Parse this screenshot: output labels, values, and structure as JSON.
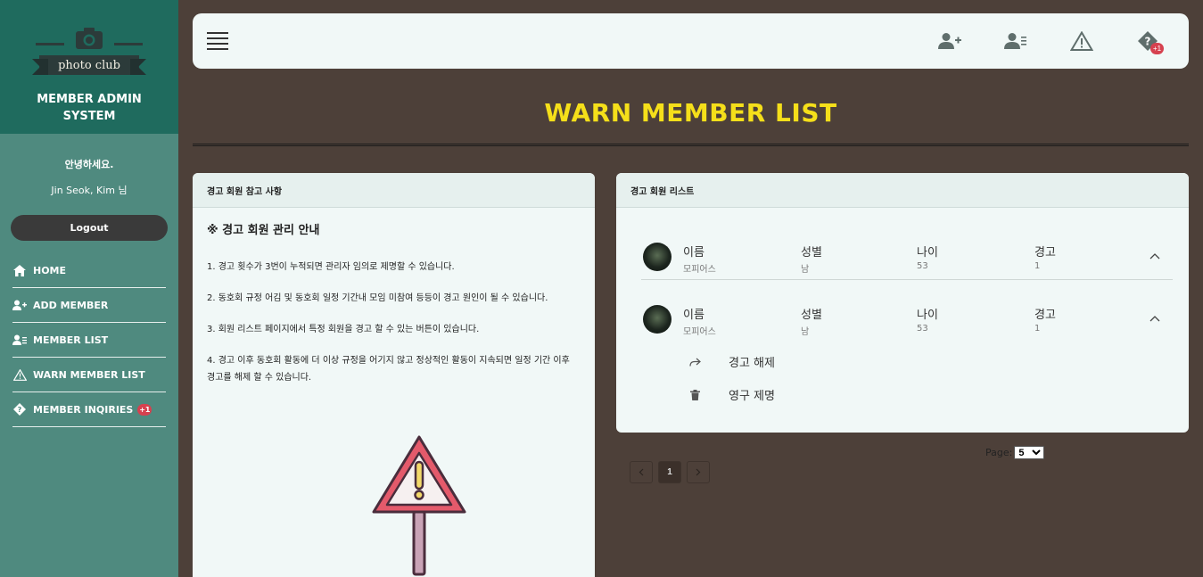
{
  "brand": {
    "logo_text": "photo club",
    "title_line1": "MEMBER ADMIN",
    "title_line2": "SYSTEM"
  },
  "user": {
    "greeting": "안녕하세요.",
    "name": "Jin Seok, Kim 님",
    "logout_label": "Logout"
  },
  "nav": [
    {
      "label": "HOME",
      "icon": "home-icon"
    },
    {
      "label": "ADD MEMBER",
      "icon": "user-plus-icon"
    },
    {
      "label": "MEMBER LIST",
      "icon": "user-list-icon"
    },
    {
      "label": "WARN MEMBER LIST",
      "icon": "warning-icon"
    },
    {
      "label": "MEMBER INQIRIES",
      "icon": "question-diamond-icon",
      "badge": "+1"
    }
  ],
  "topbar": {
    "icons": [
      "user-plus-icon",
      "user-list-icon",
      "warning-icon",
      "question-diamond-icon"
    ],
    "badge": "+1"
  },
  "page_title": "WARN MEMBER LIST",
  "left_panel": {
    "header": "경고 회원 참고 사항",
    "heading": "※ 경고 회원 관리 안내",
    "items": [
      "1. 경고 횟수가 3번이 누적되면 관리자 임의로 제명할 수 있습니다.",
      "2. 동호회 규정 어김 및 동호회 일정 기간내 모임 미참여 등등이 경고 원인이 될 수 있습니다.",
      "3. 회원 리스트 페이지에서 특정 회원을 경고 할 수 있는 버튼이 있습니다.",
      "4. 경고 이후 동호회 활동에 더 이상 규정을 어기지 않고 정상적인 활동이 지속되면 일정 기간 이후 경고를 해제 할 수 있습니다."
    ]
  },
  "right_panel": {
    "header": "경고 회원 리스트",
    "labels": {
      "name": "이름",
      "gender": "성별",
      "age": "나이",
      "warn": "경고"
    },
    "members": [
      {
        "name": "모피어스",
        "gender": "남",
        "age": "53",
        "warn": "1"
      },
      {
        "name": "모피어스",
        "gender": "남",
        "age": "53",
        "warn": "1"
      }
    ],
    "actions": {
      "release": "경고 해제",
      "expel": "영구 제명"
    }
  },
  "pagination": {
    "current": "1",
    "page_size_label": "Page:",
    "page_size": "5"
  },
  "colors": {
    "accent_title": "#f5df1a",
    "sidebar": "#4f8a7f",
    "brand_bg": "#1f6b5e",
    "background": "#4d4039",
    "badge": "#d6414f"
  }
}
